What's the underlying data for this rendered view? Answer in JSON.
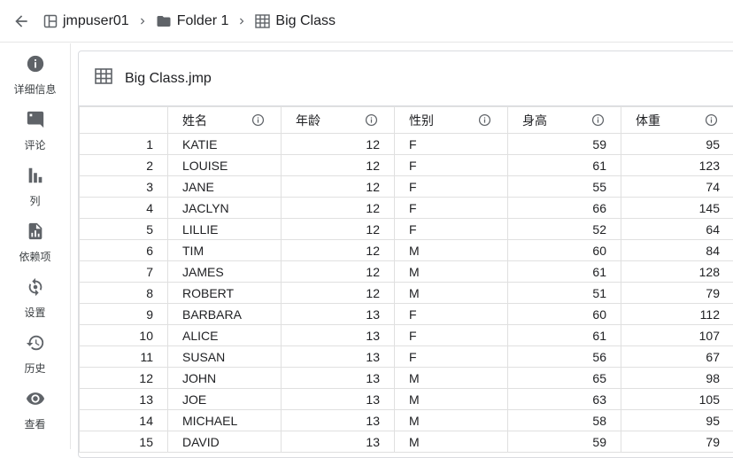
{
  "breadcrumb": {
    "items": [
      {
        "label": "jmpuser01",
        "icon": "workspace-icon"
      },
      {
        "label": "Folder 1",
        "icon": "folder-icon"
      },
      {
        "label": "Big Class",
        "icon": "table-icon"
      }
    ]
  },
  "sidebar": {
    "items": [
      {
        "label": "详细信息",
        "icon": "info-icon"
      },
      {
        "label": "评论",
        "icon": "comment-icon"
      },
      {
        "label": "列",
        "icon": "columns-chart-icon"
      },
      {
        "label": "依赖项",
        "icon": "dependency-icon"
      },
      {
        "label": "设置",
        "icon": "settings-icon"
      },
      {
        "label": "历史",
        "icon": "history-icon"
      },
      {
        "label": "查看",
        "icon": "view-icon"
      }
    ]
  },
  "panel": {
    "title": "Big Class.jmp"
  },
  "table": {
    "columns": [
      "姓名",
      "年龄",
      "性别",
      "身高",
      "体重"
    ],
    "rows": [
      [
        "1",
        "KATIE",
        "12",
        "F",
        "59",
        "95"
      ],
      [
        "2",
        "LOUISE",
        "12",
        "F",
        "61",
        "123"
      ],
      [
        "3",
        "JANE",
        "12",
        "F",
        "55",
        "74"
      ],
      [
        "4",
        "JACLYN",
        "12",
        "F",
        "66",
        "145"
      ],
      [
        "5",
        "LILLIE",
        "12",
        "F",
        "52",
        "64"
      ],
      [
        "6",
        "TIM",
        "12",
        "M",
        "60",
        "84"
      ],
      [
        "7",
        "JAMES",
        "12",
        "M",
        "61",
        "128"
      ],
      [
        "8",
        "ROBERT",
        "12",
        "M",
        "51",
        "79"
      ],
      [
        "9",
        "BARBARA",
        "13",
        "F",
        "60",
        "112"
      ],
      [
        "10",
        "ALICE",
        "13",
        "F",
        "61",
        "107"
      ],
      [
        "11",
        "SUSAN",
        "13",
        "F",
        "56",
        "67"
      ],
      [
        "12",
        "JOHN",
        "13",
        "M",
        "65",
        "98"
      ],
      [
        "13",
        "JOE",
        "13",
        "M",
        "63",
        "105"
      ],
      [
        "14",
        "MICHAEL",
        "13",
        "M",
        "58",
        "95"
      ],
      [
        "15",
        "DAVID",
        "13",
        "M",
        "59",
        "79"
      ]
    ]
  },
  "colors": {
    "icon": "#5f6368",
    "border": "#e0e0e0",
    "text": "#202124"
  }
}
